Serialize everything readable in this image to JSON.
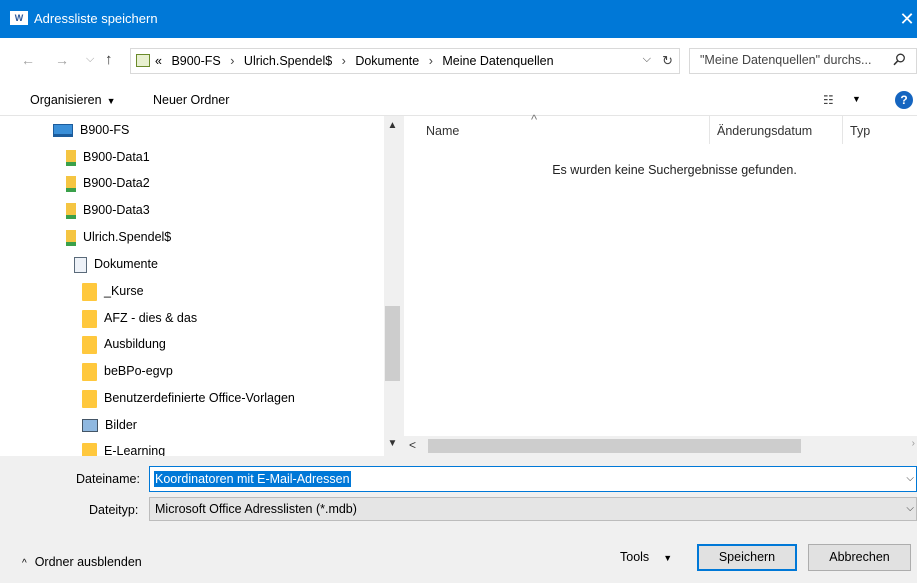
{
  "window": {
    "app_icon_text": "W",
    "title": "Adressliste speichern",
    "close_glyph": "✕"
  },
  "nav": {
    "back_glyph": "←",
    "forward_glyph": "→",
    "recent_glyph": "⌵",
    "up_glyph": "↑",
    "breadcrumb_prefix": "«",
    "breadcrumbs": [
      "B900-FS",
      "Ulrich.Spendel$",
      "Dokumente",
      "Meine Datenquellen"
    ],
    "breadcrumb_sep": "›",
    "dropdown_glyph": "⌵",
    "refresh_glyph": "↻"
  },
  "search": {
    "placeholder": "\"Meine Datenquellen\" durchs...",
    "icon": "search-icon"
  },
  "toolbar": {
    "organize_label": "Organisieren",
    "organize_caret": "▼",
    "new_folder_label": "Neuer Ordner",
    "view_glyph": "☷",
    "view_caret": "▼",
    "help_glyph": "?"
  },
  "tree": {
    "scroll_up": "▲",
    "scroll_down": "▼",
    "items": [
      {
        "label": "B900-FS",
        "icon": "computer-icon"
      },
      {
        "label": "B900-Data1",
        "icon": "network-drive-icon"
      },
      {
        "label": "B900-Data2",
        "icon": "network-drive-icon"
      },
      {
        "label": "B900-Data3",
        "icon": "network-drive-icon"
      },
      {
        "label": "Ulrich.Spendel$",
        "icon": "network-drive-icon"
      },
      {
        "label": "Dokumente",
        "icon": "documents-icon"
      },
      {
        "label": "_Kurse",
        "icon": "folder-icon"
      },
      {
        "label": "AFZ - dies & das",
        "icon": "folder-icon"
      },
      {
        "label": "Ausbildung",
        "icon": "folder-icon"
      },
      {
        "label": "beBPo-egvp",
        "icon": "folder-icon"
      },
      {
        "label": "Benutzerdefinierte Office-Vorlagen",
        "icon": "folder-icon"
      },
      {
        "label": "Bilder",
        "icon": "pictures-icon"
      },
      {
        "label": "E-Learning",
        "icon": "folder-icon"
      }
    ]
  },
  "filelist": {
    "columns": {
      "name": "Name",
      "date": "Änderungsdatum",
      "type": "Typ"
    },
    "sort_glyph": "^",
    "empty_message": "Es wurden keine Suchergebnisse gefunden.",
    "hscroll_left": "<",
    "hscroll_right": "›"
  },
  "form": {
    "filename_label": "Dateiname:",
    "filename_value": "Koordinatoren mit E-Mail-Adressen",
    "filetype_label": "Dateityp:",
    "filetype_value": "Microsoft Office Adresslisten (*.mdb)",
    "dropdown_glyph": "⌵"
  },
  "footer": {
    "hide_folders_chevron": "^",
    "hide_folders_label": "Ordner ausblenden",
    "tools_label": "Tools",
    "tools_caret": "▼",
    "save_label": "Speichern",
    "cancel_label": "Abbrechen"
  },
  "colors": {
    "accent": "#0078d7",
    "folder": "#ffc83d"
  }
}
